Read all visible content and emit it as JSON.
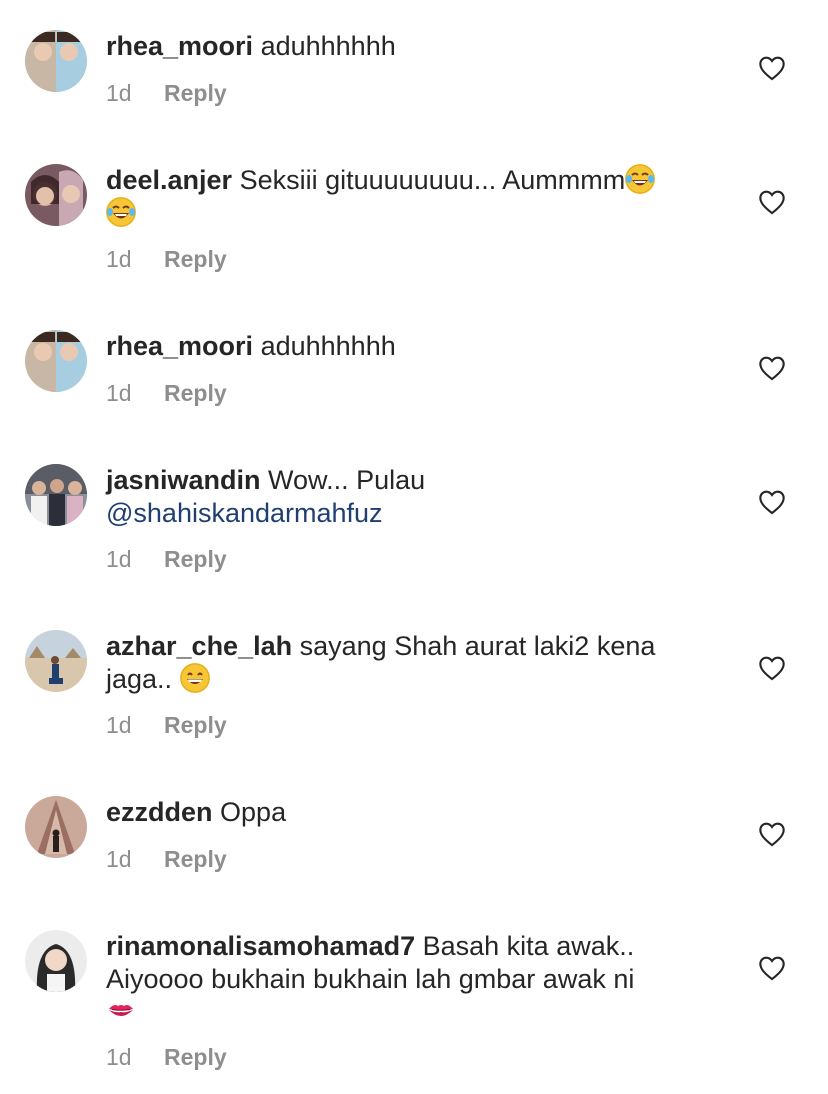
{
  "comments": [
    {
      "username": "rhea_moori",
      "text": "aduhhhhhh",
      "mention": "",
      "emoji": "",
      "time": "1d",
      "reply": "Reply",
      "avatar_colors": [
        "#c9b7a6",
        "#a7cde0"
      ]
    },
    {
      "username": "deel.anjer",
      "text": "Seksiii gituuuuuuuu... Aummmm",
      "mention": "",
      "emoji": "face-with-tears-of-joy-emoji",
      "time": "1d",
      "reply": "Reply",
      "avatar_colors": [
        "#5a3440",
        "#c7a8b3"
      ]
    },
    {
      "username": "rhea_moori",
      "text": "aduhhhhhh",
      "mention": "",
      "emoji": "",
      "time": "1d",
      "reply": "Reply",
      "avatar_colors": [
        "#c9b7a6",
        "#a7cde0"
      ]
    },
    {
      "username": "jasniwandin",
      "text": "Wow... Pulau",
      "mention": "@shahiskandarmahfuz",
      "emoji": "",
      "time": "1d",
      "reply": "Reply",
      "avatar_colors": [
        "#2c2f3a",
        "#d9b3c3"
      ]
    },
    {
      "username": "azhar_che_lah",
      "text": "sayang Shah aurat laki2 kena jaga..",
      "mention": "",
      "emoji": "grinning-face-emoji",
      "time": "1d",
      "reply": "Reply",
      "avatar_colors": [
        "#c2ac90",
        "#1f3f6e"
      ]
    },
    {
      "username": "ezzdden",
      "text": "Oppa",
      "mention": "",
      "emoji": "",
      "time": "1d",
      "reply": "Reply",
      "avatar_colors": [
        "#b48c7a",
        "#3a2a25"
      ]
    },
    {
      "username": "rinamonalisamohamad7",
      "text": "Basah kita awak.. Aiyoooo bukhain bukhain lah gmbar awak ni",
      "mention": "",
      "emoji": "kiss-mark-emoji",
      "time": "1d",
      "reply": "Reply",
      "avatar_colors": [
        "#e8e8e8",
        "#2a2a2a"
      ]
    }
  ],
  "colors": {
    "text": "#262626",
    "muted": "#8e8e8e",
    "mention": "#1f3f73"
  }
}
